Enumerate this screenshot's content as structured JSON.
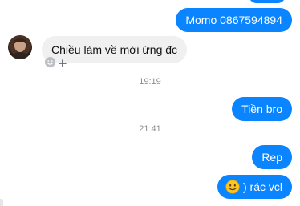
{
  "messages": [
    {
      "side": "out",
      "text": "Momo 0867594894"
    },
    {
      "side": "in",
      "text": "Chiều làm về mới ứng đc"
    },
    {
      "type": "time",
      "text": "19:19"
    },
    {
      "side": "out",
      "text": "Tiền bro"
    },
    {
      "type": "time",
      "text": "21:41"
    },
    {
      "side": "out",
      "text": "Rep"
    },
    {
      "side": "out",
      "emoji": "slightly-smiling-face",
      "text": ") rác vcl"
    }
  ],
  "colors": {
    "outgoing": "#0a84ff",
    "incoming": "#f1f0f0",
    "timestamp": "#8a8d91"
  },
  "icons": {
    "reaction": "smiley-outline-icon",
    "add_reaction": "plus-icon"
  }
}
